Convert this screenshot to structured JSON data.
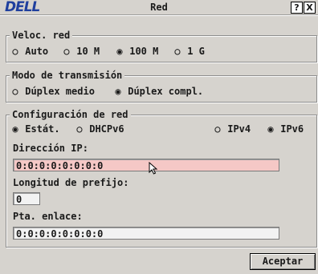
{
  "window": {
    "logo": "DELL",
    "title": "Red",
    "help_btn": "?",
    "close_btn": "X"
  },
  "speed": {
    "legend": "Veloc. red",
    "options": [
      "Auto",
      "10 M",
      "100 M",
      "1 G"
    ],
    "selected": "100 M"
  },
  "duplex": {
    "legend": "Modo de transmisión",
    "options": [
      "Dúplex medio",
      "Dúplex compl."
    ],
    "selected": "Dúplex compl."
  },
  "netconfig": {
    "legend": "Configuración de red",
    "mode_options": [
      "Estát.",
      "DHCPv6"
    ],
    "mode_selected": "Estát.",
    "ip_options": [
      "IPv4",
      "IPv6"
    ],
    "ip_selected": "IPv6",
    "ip_label": "Dirección IP:",
    "ip_value": "0:0:0:0:0:0:0:0",
    "prefix_label": "Longitud de prefijo:",
    "prefix_value": "0",
    "gateway_label": "Pta. enlace:",
    "gateway_value": "0:0:0:0:0:0:0:0"
  },
  "accept_label": "Aceptar"
}
